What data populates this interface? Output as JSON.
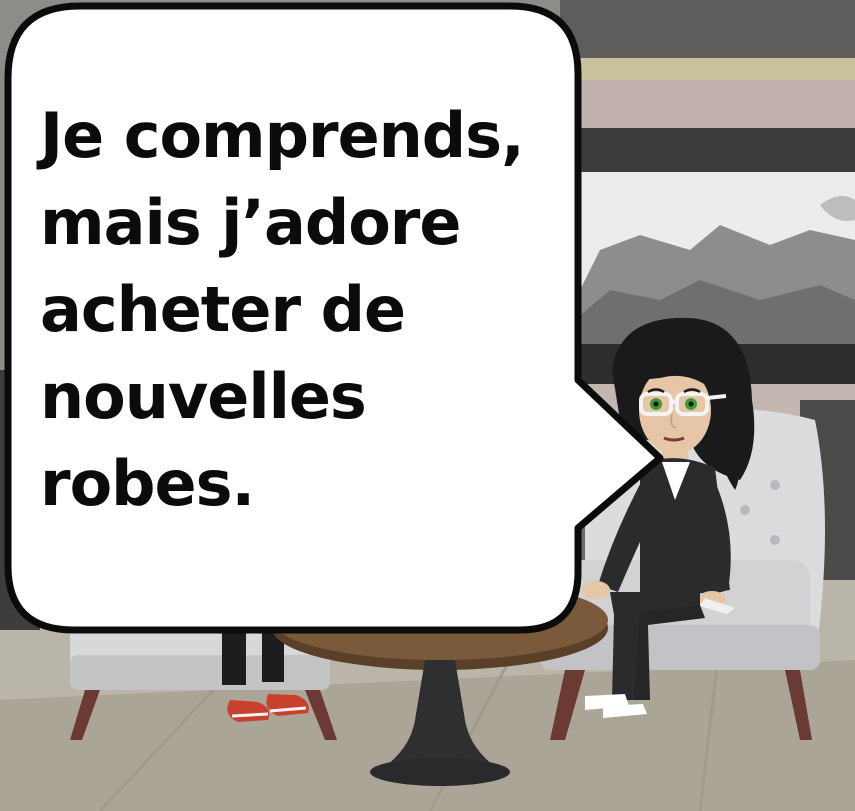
{
  "speech_bubble": {
    "lines": [
      "Je comprends,",
      "mais j’adore",
      "acheter de",
      "nouvelles",
      "robes."
    ]
  },
  "colors": {
    "bubble_fill": "#ffffff",
    "bubble_outline": "#0b0b0b",
    "wall": "#8e8c89",
    "floor": "#b9b5a9",
    "armchair": "#d7d7d9",
    "table_top": "#7a5a3b",
    "woman_hair": "#1a1a1c",
    "woman_suit": "#2b2b2e",
    "eye_color": "#3f9a3a",
    "sneaker": "#c9402e"
  }
}
